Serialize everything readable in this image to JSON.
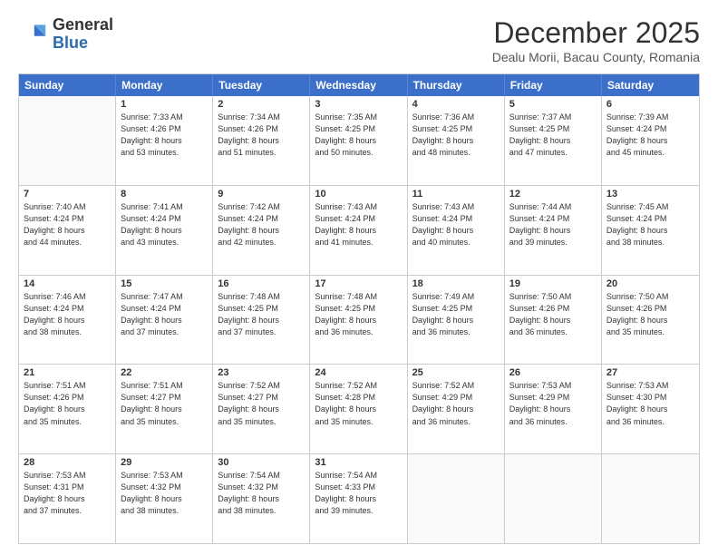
{
  "logo": {
    "general": "General",
    "blue": "Blue"
  },
  "title": "December 2025",
  "location": "Dealu Morii, Bacau County, Romania",
  "days_of_week": [
    "Sunday",
    "Monday",
    "Tuesday",
    "Wednesday",
    "Thursday",
    "Friday",
    "Saturday"
  ],
  "weeks": [
    [
      {
        "day": "",
        "info": ""
      },
      {
        "day": "1",
        "info": "Sunrise: 7:33 AM\nSunset: 4:26 PM\nDaylight: 8 hours\nand 53 minutes."
      },
      {
        "day": "2",
        "info": "Sunrise: 7:34 AM\nSunset: 4:26 PM\nDaylight: 8 hours\nand 51 minutes."
      },
      {
        "day": "3",
        "info": "Sunrise: 7:35 AM\nSunset: 4:25 PM\nDaylight: 8 hours\nand 50 minutes."
      },
      {
        "day": "4",
        "info": "Sunrise: 7:36 AM\nSunset: 4:25 PM\nDaylight: 8 hours\nand 48 minutes."
      },
      {
        "day": "5",
        "info": "Sunrise: 7:37 AM\nSunset: 4:25 PM\nDaylight: 8 hours\nand 47 minutes."
      },
      {
        "day": "6",
        "info": "Sunrise: 7:39 AM\nSunset: 4:24 PM\nDaylight: 8 hours\nand 45 minutes."
      }
    ],
    [
      {
        "day": "7",
        "info": "Sunrise: 7:40 AM\nSunset: 4:24 PM\nDaylight: 8 hours\nand 44 minutes."
      },
      {
        "day": "8",
        "info": "Sunrise: 7:41 AM\nSunset: 4:24 PM\nDaylight: 8 hours\nand 43 minutes."
      },
      {
        "day": "9",
        "info": "Sunrise: 7:42 AM\nSunset: 4:24 PM\nDaylight: 8 hours\nand 42 minutes."
      },
      {
        "day": "10",
        "info": "Sunrise: 7:43 AM\nSunset: 4:24 PM\nDaylight: 8 hours\nand 41 minutes."
      },
      {
        "day": "11",
        "info": "Sunrise: 7:43 AM\nSunset: 4:24 PM\nDaylight: 8 hours\nand 40 minutes."
      },
      {
        "day": "12",
        "info": "Sunrise: 7:44 AM\nSunset: 4:24 PM\nDaylight: 8 hours\nand 39 minutes."
      },
      {
        "day": "13",
        "info": "Sunrise: 7:45 AM\nSunset: 4:24 PM\nDaylight: 8 hours\nand 38 minutes."
      }
    ],
    [
      {
        "day": "14",
        "info": "Sunrise: 7:46 AM\nSunset: 4:24 PM\nDaylight: 8 hours\nand 38 minutes."
      },
      {
        "day": "15",
        "info": "Sunrise: 7:47 AM\nSunset: 4:24 PM\nDaylight: 8 hours\nand 37 minutes."
      },
      {
        "day": "16",
        "info": "Sunrise: 7:48 AM\nSunset: 4:25 PM\nDaylight: 8 hours\nand 37 minutes."
      },
      {
        "day": "17",
        "info": "Sunrise: 7:48 AM\nSunset: 4:25 PM\nDaylight: 8 hours\nand 36 minutes."
      },
      {
        "day": "18",
        "info": "Sunrise: 7:49 AM\nSunset: 4:25 PM\nDaylight: 8 hours\nand 36 minutes."
      },
      {
        "day": "19",
        "info": "Sunrise: 7:50 AM\nSunset: 4:26 PM\nDaylight: 8 hours\nand 36 minutes."
      },
      {
        "day": "20",
        "info": "Sunrise: 7:50 AM\nSunset: 4:26 PM\nDaylight: 8 hours\nand 35 minutes."
      }
    ],
    [
      {
        "day": "21",
        "info": "Sunrise: 7:51 AM\nSunset: 4:26 PM\nDaylight: 8 hours\nand 35 minutes."
      },
      {
        "day": "22",
        "info": "Sunrise: 7:51 AM\nSunset: 4:27 PM\nDaylight: 8 hours\nand 35 minutes."
      },
      {
        "day": "23",
        "info": "Sunrise: 7:52 AM\nSunset: 4:27 PM\nDaylight: 8 hours\nand 35 minutes."
      },
      {
        "day": "24",
        "info": "Sunrise: 7:52 AM\nSunset: 4:28 PM\nDaylight: 8 hours\nand 35 minutes."
      },
      {
        "day": "25",
        "info": "Sunrise: 7:52 AM\nSunset: 4:29 PM\nDaylight: 8 hours\nand 36 minutes."
      },
      {
        "day": "26",
        "info": "Sunrise: 7:53 AM\nSunset: 4:29 PM\nDaylight: 8 hours\nand 36 minutes."
      },
      {
        "day": "27",
        "info": "Sunrise: 7:53 AM\nSunset: 4:30 PM\nDaylight: 8 hours\nand 36 minutes."
      }
    ],
    [
      {
        "day": "28",
        "info": "Sunrise: 7:53 AM\nSunset: 4:31 PM\nDaylight: 8 hours\nand 37 minutes."
      },
      {
        "day": "29",
        "info": "Sunrise: 7:53 AM\nSunset: 4:32 PM\nDaylight: 8 hours\nand 38 minutes."
      },
      {
        "day": "30",
        "info": "Sunrise: 7:54 AM\nSunset: 4:32 PM\nDaylight: 8 hours\nand 38 minutes."
      },
      {
        "day": "31",
        "info": "Sunrise: 7:54 AM\nSunset: 4:33 PM\nDaylight: 8 hours\nand 39 minutes."
      },
      {
        "day": "",
        "info": ""
      },
      {
        "day": "",
        "info": ""
      },
      {
        "day": "",
        "info": ""
      }
    ]
  ]
}
